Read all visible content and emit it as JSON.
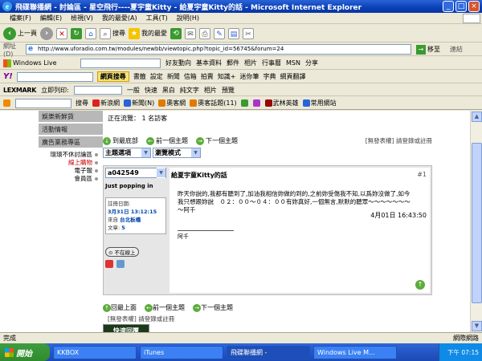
{
  "window": {
    "title": "飛碟聯播網 - 討論區 - 星空飛行----夏宇童Kitty - 給夏宇童Kitty的話 - Microsoft Internet Explorer"
  },
  "menu": [
    "檔案(F)",
    "編輯(E)",
    "檢視(V)",
    "我的最愛(A)",
    "工具(T)",
    "說明(H)"
  ],
  "toolbar": {
    "back": "上一頁",
    "search": "搜尋",
    "favorites": "我的最愛"
  },
  "address": {
    "label": "網址(D)",
    "url": "http://www.uforadio.com.tw/modules/newbb/viewtopic.php?topic_id=56745&forum=24",
    "go": "移至",
    "links": "連結"
  },
  "live": {
    "brand": "Windows Live",
    "items": [
      "好友動向",
      "基本資料",
      "郵件",
      "相片",
      "行事曆",
      "MSN",
      "分享"
    ]
  },
  "yahoo": {
    "search_btn": "網頁搜尋",
    "items": [
      "書籤",
      "設定",
      "新聞",
      "信箱",
      "拍賣",
      "知識+",
      "迷你筆",
      "字典",
      "網頁翻譯"
    ]
  },
  "lexmark": {
    "brand": "LEXMARK",
    "print": "立即列印:",
    "items": [
      "一般",
      "快速",
      "黑白",
      "純文字",
      "相片",
      "預覽"
    ]
  },
  "bookmarks": {
    "search": "搜尋",
    "items": [
      "新浪網",
      "新聞(N)",
      "奧客網",
      "奧客話題(11)",
      "武林英雄",
      "常用網站"
    ]
  },
  "sidebar": {
    "items": [
      "娛樂新鮮貨",
      "活動情報",
      "廣告業務專區"
    ],
    "links": [
      "環環不休討論區",
      "線上購物",
      "電子報",
      "會員區"
    ]
  },
  "viewers": "正在流覽：  1 名訪客",
  "nav": {
    "bottom": "到最底部",
    "prev_topic": "前一個主題",
    "next_topic": "下一個主題",
    "perm": "[無發表權] 請登錄或註冊"
  },
  "selects": {
    "topic": "主題選項",
    "view": "瀏覽模式"
  },
  "post": {
    "author": "a042549",
    "status": "Just popping in",
    "join_label": "註冊日期:",
    "join_date": "3月31日 13:12:15",
    "from_label": "來自",
    "from": "台北板橋",
    "posts_label": "文章:",
    "posts": "5",
    "online": "不在線上",
    "subject": "給夏宇童Kitty的話",
    "number": "#1",
    "body": "昨天你說的,我都有聽到了,加油我相信妳做的到的,之前妳受傷我不知,以爲妳沒做了,如今我只想跟妳說　０２：００～０４：００有妳真好,一個無言,默默的聽眾～～～～～～～～阿千",
    "date": "4月01日 16:43:50",
    "signature": "阿千"
  },
  "bottom": {
    "top": "回最上面",
    "prev_topic": "前一個主題",
    "next_topic": "下一個主題",
    "perm": "[無發表權] 請登錄或註冊",
    "quick_reply": "快速回覆"
  },
  "status": {
    "text": "完成",
    "zone": "網際網路"
  },
  "taskbar": {
    "start": "開始",
    "tasks": [
      "KKBOX",
      "iTunes",
      "飛碟聯播網 -",
      "Windows Live M..."
    ],
    "time": "下午 07:15"
  }
}
